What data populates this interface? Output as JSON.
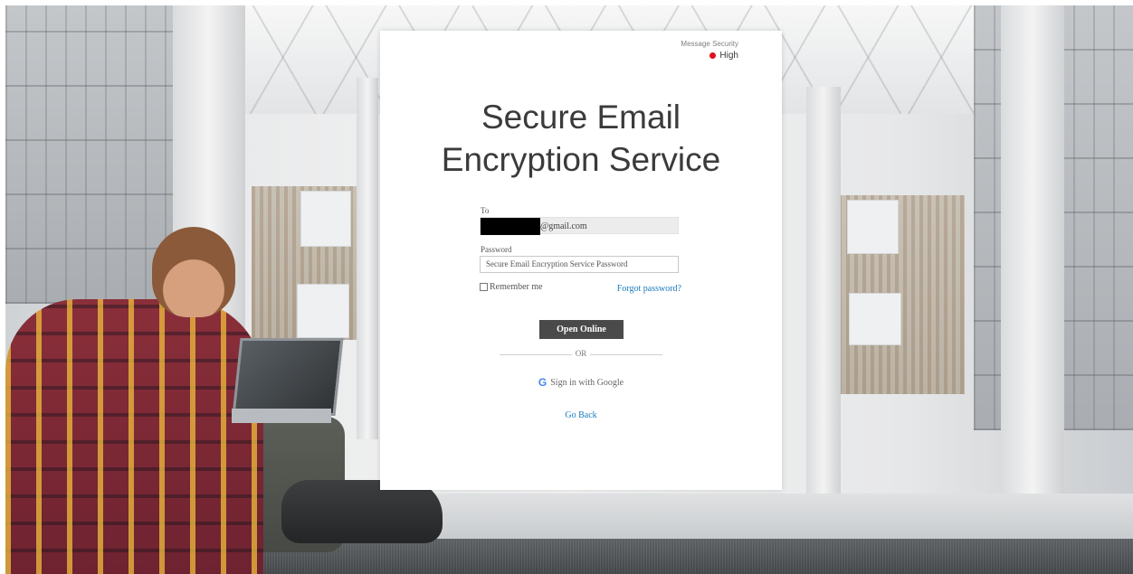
{
  "security": {
    "label": "Message Security",
    "level": "High",
    "level_color": "#e00f1c"
  },
  "title": {
    "line1": "Secure Email",
    "line2": "Encryption Service"
  },
  "form": {
    "to_label": "To",
    "to_value": "@gmail.com",
    "password_label": "Password",
    "password_placeholder": "Secure Email Encryption Service Password",
    "remember_label": "Remember me",
    "forgot_label": "Forgot password?",
    "open_button": "Open Online",
    "or_text": "OR",
    "google_label": "Sign in with Google",
    "google_icon": "google-g-icon",
    "go_back": "Go Back"
  },
  "colors": {
    "link": "#1a7bbd",
    "button_bg": "#4a4a4a"
  }
}
